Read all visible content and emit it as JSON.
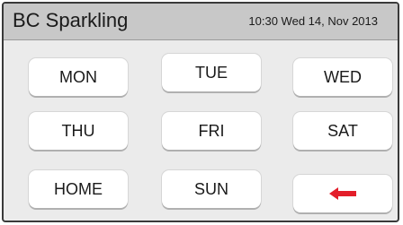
{
  "header": {
    "title": "BC Sparkling",
    "datetime": "10:30 Wed 14, Nov 2013"
  },
  "buttons": {
    "mon": "MON",
    "tue": "TUE",
    "wed": "WED",
    "thu": "THU",
    "fri": "FRI",
    "sat": "SAT",
    "home": "HOME",
    "sun": "SUN",
    "back_icon": "left-arrow-icon"
  },
  "colors": {
    "back_arrow": "#e31e2a",
    "titlebar": "#c8c8c8",
    "background": "#ebebeb"
  }
}
